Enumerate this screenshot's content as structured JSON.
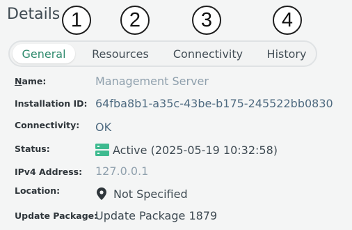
{
  "header": {
    "title": "Details"
  },
  "callouts": [
    "1",
    "2",
    "3",
    "4"
  ],
  "tabs": [
    {
      "label": "General",
      "active": true
    },
    {
      "label": "Resources",
      "active": false
    },
    {
      "label": "Connectivity",
      "active": false
    },
    {
      "label": "History",
      "active": false
    }
  ],
  "fields": {
    "name": {
      "label_first": "N",
      "label_rest": "ame:",
      "value": "Management Server"
    },
    "installation_id": {
      "label": "Installation ID:",
      "value": "64fba8b1-a35c-43be-b175-245522bb0830"
    },
    "connectivity": {
      "label": "Connectivity:",
      "value": "OK"
    },
    "status": {
      "label": "Status:",
      "value": "Active (2025-05-19 10:32:58)",
      "icon": "server-active-icon",
      "icon_color": "#3dba8f"
    },
    "ipv4": {
      "label": "IPv4 Address:",
      "value": "127.0.0.1"
    },
    "location": {
      "label": "Location:",
      "value": "Not Specified",
      "icon": "map-pin-icon"
    },
    "update_package": {
      "label": "Update Package:",
      "value": "Update Package 1879"
    }
  },
  "colors": {
    "accent": "#2e8a6c",
    "status_green": "#3dba8f",
    "value_blue": "#4e6a80"
  }
}
